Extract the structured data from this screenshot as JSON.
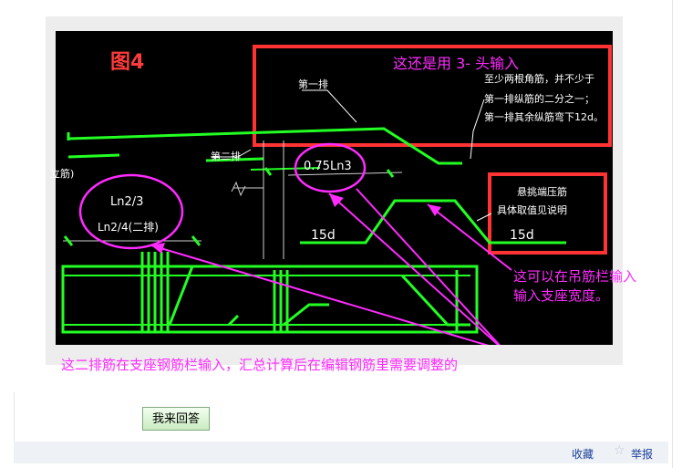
{
  "figure": {
    "title": "图4",
    "labels": {
      "first_row": "第一排",
      "second_row": "第二排",
      "note_line1": "至少两根角筋，并不少于",
      "note_line2": "第一排纵筋的二分之一；",
      "note_line3": "第一排其余纵筋弯下12d。",
      "cantilever_line1": "悬挑端压筋",
      "cantilever_line2": "具体取值见说明",
      "ln2_3": "Ln2/3",
      "ln2_4": "Ln2/4(二排)",
      "ln3": "0.75Ln3",
      "d15_left": "15d",
      "d15_right": "15d",
      "left_partial": "立筋)"
    },
    "annotations": {
      "top": "这还是用 3-  头输入",
      "right_line1": "这可以在吊筋栏输入",
      "right_line2": "输入支座宽度。",
      "bottom": "这二排筋在支座钢筋栏输入，汇总计算后在编辑钢筋里需要调整的"
    },
    "colors": {
      "cad_background": "#000000",
      "rebar": "#22ff22",
      "highlight_box": "#ff3333",
      "annotation": "#ff2bff"
    }
  },
  "actions": {
    "answer_button": "我来回答",
    "favorite": "收藏",
    "report": "举报"
  }
}
